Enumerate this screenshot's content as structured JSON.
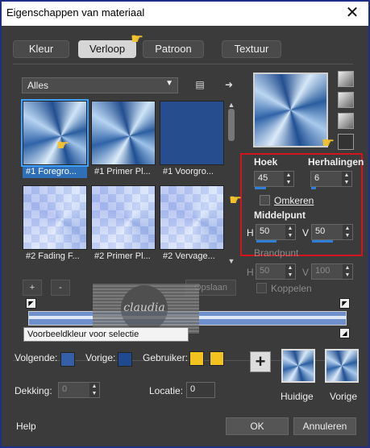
{
  "window": {
    "title": "Eigenschappen van materiaal"
  },
  "tabs": [
    {
      "label": "Kleur"
    },
    {
      "label": "Verloop"
    },
    {
      "label": "Patroon"
    },
    {
      "label": "Textuur"
    }
  ],
  "active_tab": "Verloop",
  "category": {
    "selected": "Alles"
  },
  "thumbnails": [
    {
      "caption": "#1 Foregro..."
    },
    {
      "caption": "#1 Primer Pl..."
    },
    {
      "caption": "#1 Voorgro..."
    },
    {
      "caption": "#2 Fading F..."
    },
    {
      "caption": "#2 Primer Pl..."
    },
    {
      "caption": "#2 Vervage..."
    }
  ],
  "gradient": {
    "hoek_label": "Hoek",
    "hoek_value": "45",
    "herhalingen_label": "Herhalingen",
    "herhalingen_value": "6",
    "omkeren_label": "Omkeren",
    "middelpunt_label": "Middelpunt",
    "h_label": "H",
    "h_value": "50",
    "v_label": "V",
    "v_value": "50",
    "brandpunt_label": "Brandpunt",
    "bh_label": "H",
    "bh_value": "50",
    "bv_label": "V",
    "bv_value": "100",
    "koppelen_label": "Koppelen"
  },
  "editor": {
    "add": "+",
    "remove": "-",
    "save": "Opslaan",
    "tooltip": "Voorbeeldkleur voor selectie",
    "watermark": "claudia"
  },
  "stops": {
    "volgende_label": "Volgende:",
    "vorige_label": "Vorige:",
    "gebruiker_label": "Gebruiker:",
    "dekking_label": "Dekking:",
    "dekking_value": "0",
    "locatie_label": "Locatie:",
    "locatie_value": "0",
    "user_color": "#f2c21e"
  },
  "previews": {
    "huidige": "Huidige",
    "vorige": "Vorige"
  },
  "footer": {
    "help": "Help",
    "ok": "OK",
    "cancel": "Annuleren"
  }
}
